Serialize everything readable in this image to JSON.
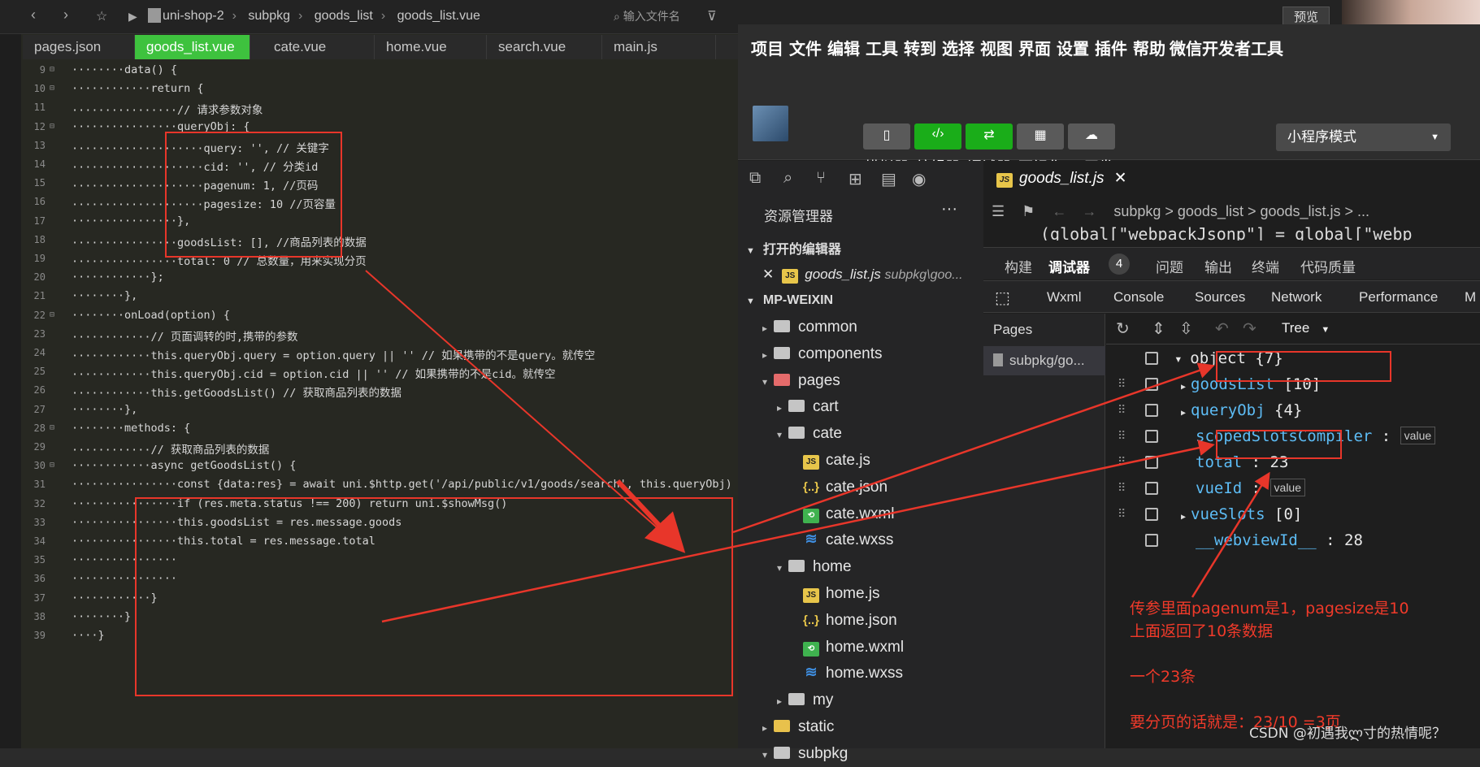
{
  "editor": {
    "breadcrumb": [
      "uni-shop-2",
      "subpkg",
      "goods_list",
      "goods_list.vue"
    ],
    "search_placeholder": "输入文件名",
    "tabs": [
      "pages.json",
      "goods_list.vue",
      "cate.vue",
      "home.vue",
      "search.vue",
      "main.js"
    ],
    "active_tab": "goods_list.vue",
    "line_numbers": [
      "9",
      "10",
      "11",
      "12",
      "13",
      "14",
      "15",
      "16",
      "17",
      "18",
      "19",
      "20",
      "21",
      "22",
      "23",
      "24",
      "25",
      "26",
      "27",
      "28",
      "29",
      "30",
      "31",
      "32",
      "33",
      "34",
      "35",
      "36",
      "37",
      "38",
      "39"
    ]
  },
  "code_lines": [
    "········data() {",
    "············return {",
    "················// 请求参数对象",
    "················queryObj: {",
    "····················query: '', // 关键字",
    "····················cid: '', // 分类id",
    "····················pagenum: 1, //页码",
    "····················pagesize: 10 //页容量",
    "················},",
    "················goodsList: [], //商品列表的数据",
    "················total: 0 // 总数量，用来实现分页",
    "············};",
    "········},",
    "········onLoad(option) {",
    "············// 页面调转的时,携带的参数",
    "············this.queryObj.query = option.query || '' // 如果携带的不是query。就传空",
    "············this.queryObj.cid = option.cid || '' // 如果携带的不是cid。就传空",
    "············this.getGoodsList() // 获取商品列表的数据",
    "········},",
    "········methods: {",
    "············// 获取商品列表的数据",
    "············async getGoodsList() {",
    "················const {data:res} = await uni.$http.get('/api/public/v1/goods/search', this.queryObj)",
    "················if (res.meta.status !== 200) return uni.$showMsg()",
    "················this.goodsList = res.message.goods",
    "················this.total = res.message.total",
    "················",
    "················",
    "············}",
    "········}",
    "····}"
  ],
  "wx": {
    "preview_label": "预览",
    "menu": [
      "项目",
      "文件",
      "编辑",
      "工具",
      "转到",
      "选择",
      "视图",
      "界面",
      "设置",
      "插件",
      "帮助",
      "微信开发者工具"
    ],
    "toolbar_buttons": [
      "模拟器",
      "编辑器",
      "调试器",
      "可视化",
      "云开发"
    ],
    "toolbar_colors": [
      "#5a5a5a",
      "#1aad19",
      "#1aad19",
      "#5a5a5a",
      "#5a5a5a"
    ],
    "mode_select": "小程序模式",
    "explorer_title": "资源管理器",
    "open_editors": "打开的编辑器",
    "open_file": "goods_list.js",
    "open_file_path": "subpkg\\goo...",
    "project": "MP-WEIXIN",
    "tree": [
      {
        "label": "common",
        "type": "folder"
      },
      {
        "label": "components",
        "type": "folder"
      },
      {
        "label": "pages",
        "type": "folder-special"
      },
      {
        "label": "cart",
        "type": "folder"
      },
      {
        "label": "cate",
        "type": "folder"
      },
      {
        "label": "cate.js",
        "type": "js"
      },
      {
        "label": "cate.json",
        "type": "json"
      },
      {
        "label": "cate.wxml",
        "type": "wxml"
      },
      {
        "label": "cate.wxss",
        "type": "wxss"
      },
      {
        "label": "home",
        "type": "folder"
      },
      {
        "label": "home.js",
        "type": "js"
      },
      {
        "label": "home.json",
        "type": "json"
      },
      {
        "label": "home.wxml",
        "type": "wxml"
      },
      {
        "label": "home.wxss",
        "type": "wxss"
      },
      {
        "label": "my",
        "type": "folder"
      },
      {
        "label": "static",
        "type": "folder-yellow"
      },
      {
        "label": "subpkg",
        "type": "folder"
      }
    ],
    "file_tab": "goods_list.js",
    "file_breadcrumb": "subpkg > goods_list > goods_list.js > ...",
    "code_line": "(global[\"webpackJsonp\"] = global[\"webp",
    "debug_tabs": [
      "构建",
      "调试器",
      "问题",
      "输出",
      "终端",
      "代码质量"
    ],
    "debug_badge": "4",
    "panel_tabs": [
      "Wxml",
      "Console",
      "Sources",
      "Network",
      "Performance",
      "M"
    ],
    "pages_header": "Pages",
    "pages_item": "subpkg/go...",
    "view_mode": "Tree",
    "object_root": "object {7}",
    "object_rows": [
      {
        "key": "goodsList",
        "value": "[10]",
        "expandable": true
      },
      {
        "key": "queryObj",
        "value": "{4}",
        "expandable": true
      },
      {
        "key": "scopedSlotsCompiler",
        "value": "value",
        "expandable": false
      },
      {
        "key": "total",
        "value": "23",
        "expandable": false
      },
      {
        "key": "vueId",
        "value": "value",
        "expandable": false
      },
      {
        "key": "vueSlots",
        "value": "[0]",
        "expandable": true
      },
      {
        "key": "__webviewId__",
        "value": "28",
        "expandable": false
      }
    ]
  },
  "annotation": {
    "note": "传参里面pagenum是1，pagesize是10\n上面返回了10条数据\n\n一个23条\n\n要分页的话就是：23/10 =3页",
    "watermark": "CSDN @初遇我ლ寸的热情呢？"
  },
  "colors": {
    "accent_red": "#e8362a",
    "active_tab": "#3ec23e"
  }
}
